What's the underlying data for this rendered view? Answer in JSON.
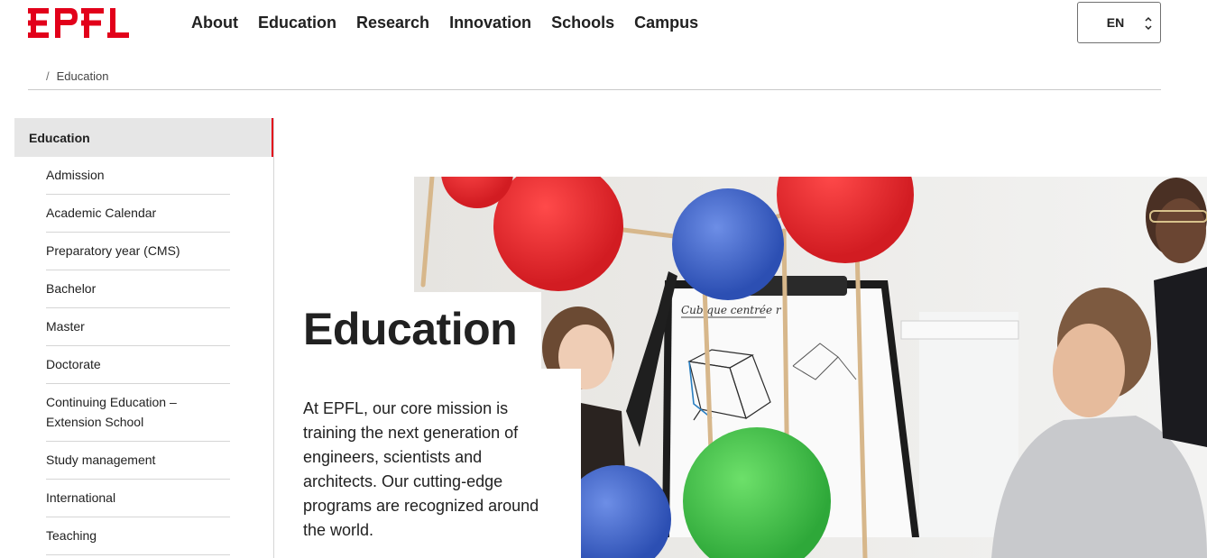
{
  "header": {
    "logo_text": "EPFL",
    "nav": [
      "About",
      "Education",
      "Research",
      "Innovation",
      "Schools",
      "Campus"
    ],
    "language": "EN"
  },
  "breadcrumb": {
    "separator": "/",
    "current": "Education"
  },
  "sidebar": {
    "title": "Education",
    "items": [
      "Admission",
      "Academic Calendar",
      "Preparatory year (CMS)",
      "Bachelor",
      "Master",
      "Doctorate",
      "Continuing Education – Extension School",
      "Study management",
      "International",
      "Teaching"
    ]
  },
  "hero": {
    "title": "Education",
    "lead": "At EPFL, our core mission is training the next generation of engineers, scientists and architects. Our cutting-edge programs are recognized around the world.",
    "whiteboard_text": "Cubique centrée r"
  },
  "colors": {
    "brand_red": "#e2001a",
    "text": "#212121",
    "sidebar_active_bg": "#e6e6e6"
  }
}
